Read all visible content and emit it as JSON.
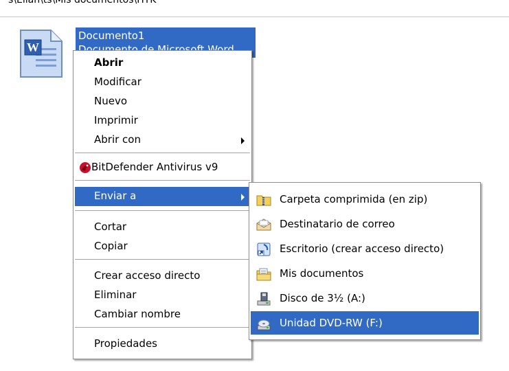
{
  "address_bar": {
    "path": "s\\Ellan\\ts\\Mis documentos\\HTK"
  },
  "file": {
    "name": "Documento1",
    "type_text": "Documento de Microsoft Word",
    "icon": "word-document-icon"
  },
  "context_menu": {
    "open": "Abrir",
    "edit": "Modificar",
    "new": "Nuevo",
    "print": "Imprimir",
    "open_with": "Abrir con",
    "antivirus": "BitDefender Antivirus v9",
    "send_to": "Enviar a",
    "cut": "Cortar",
    "copy": "Copiar",
    "create_shortcut": "Crear acceso directo",
    "delete": "Eliminar",
    "rename": "Cambiar nombre",
    "properties": "Propiedades"
  },
  "send_to_menu": [
    {
      "label": "Carpeta comprimida (en zip)",
      "icon": "zip-folder-icon"
    },
    {
      "label": "Destinatario de correo",
      "icon": "mail-recipient-icon"
    },
    {
      "label": "Escritorio (crear acceso directo)",
      "icon": "desktop-shortcut-icon"
    },
    {
      "label": "Mis documentos",
      "icon": "my-documents-icon"
    },
    {
      "label": "Disco de 3½ (A:)",
      "icon": "floppy-drive-icon"
    },
    {
      "label": "Unidad DVD-RW (F:)",
      "icon": "dvd-drive-icon"
    }
  ],
  "colors": {
    "highlight": "#316ac5",
    "menu_border": "#8d8d8d"
  }
}
